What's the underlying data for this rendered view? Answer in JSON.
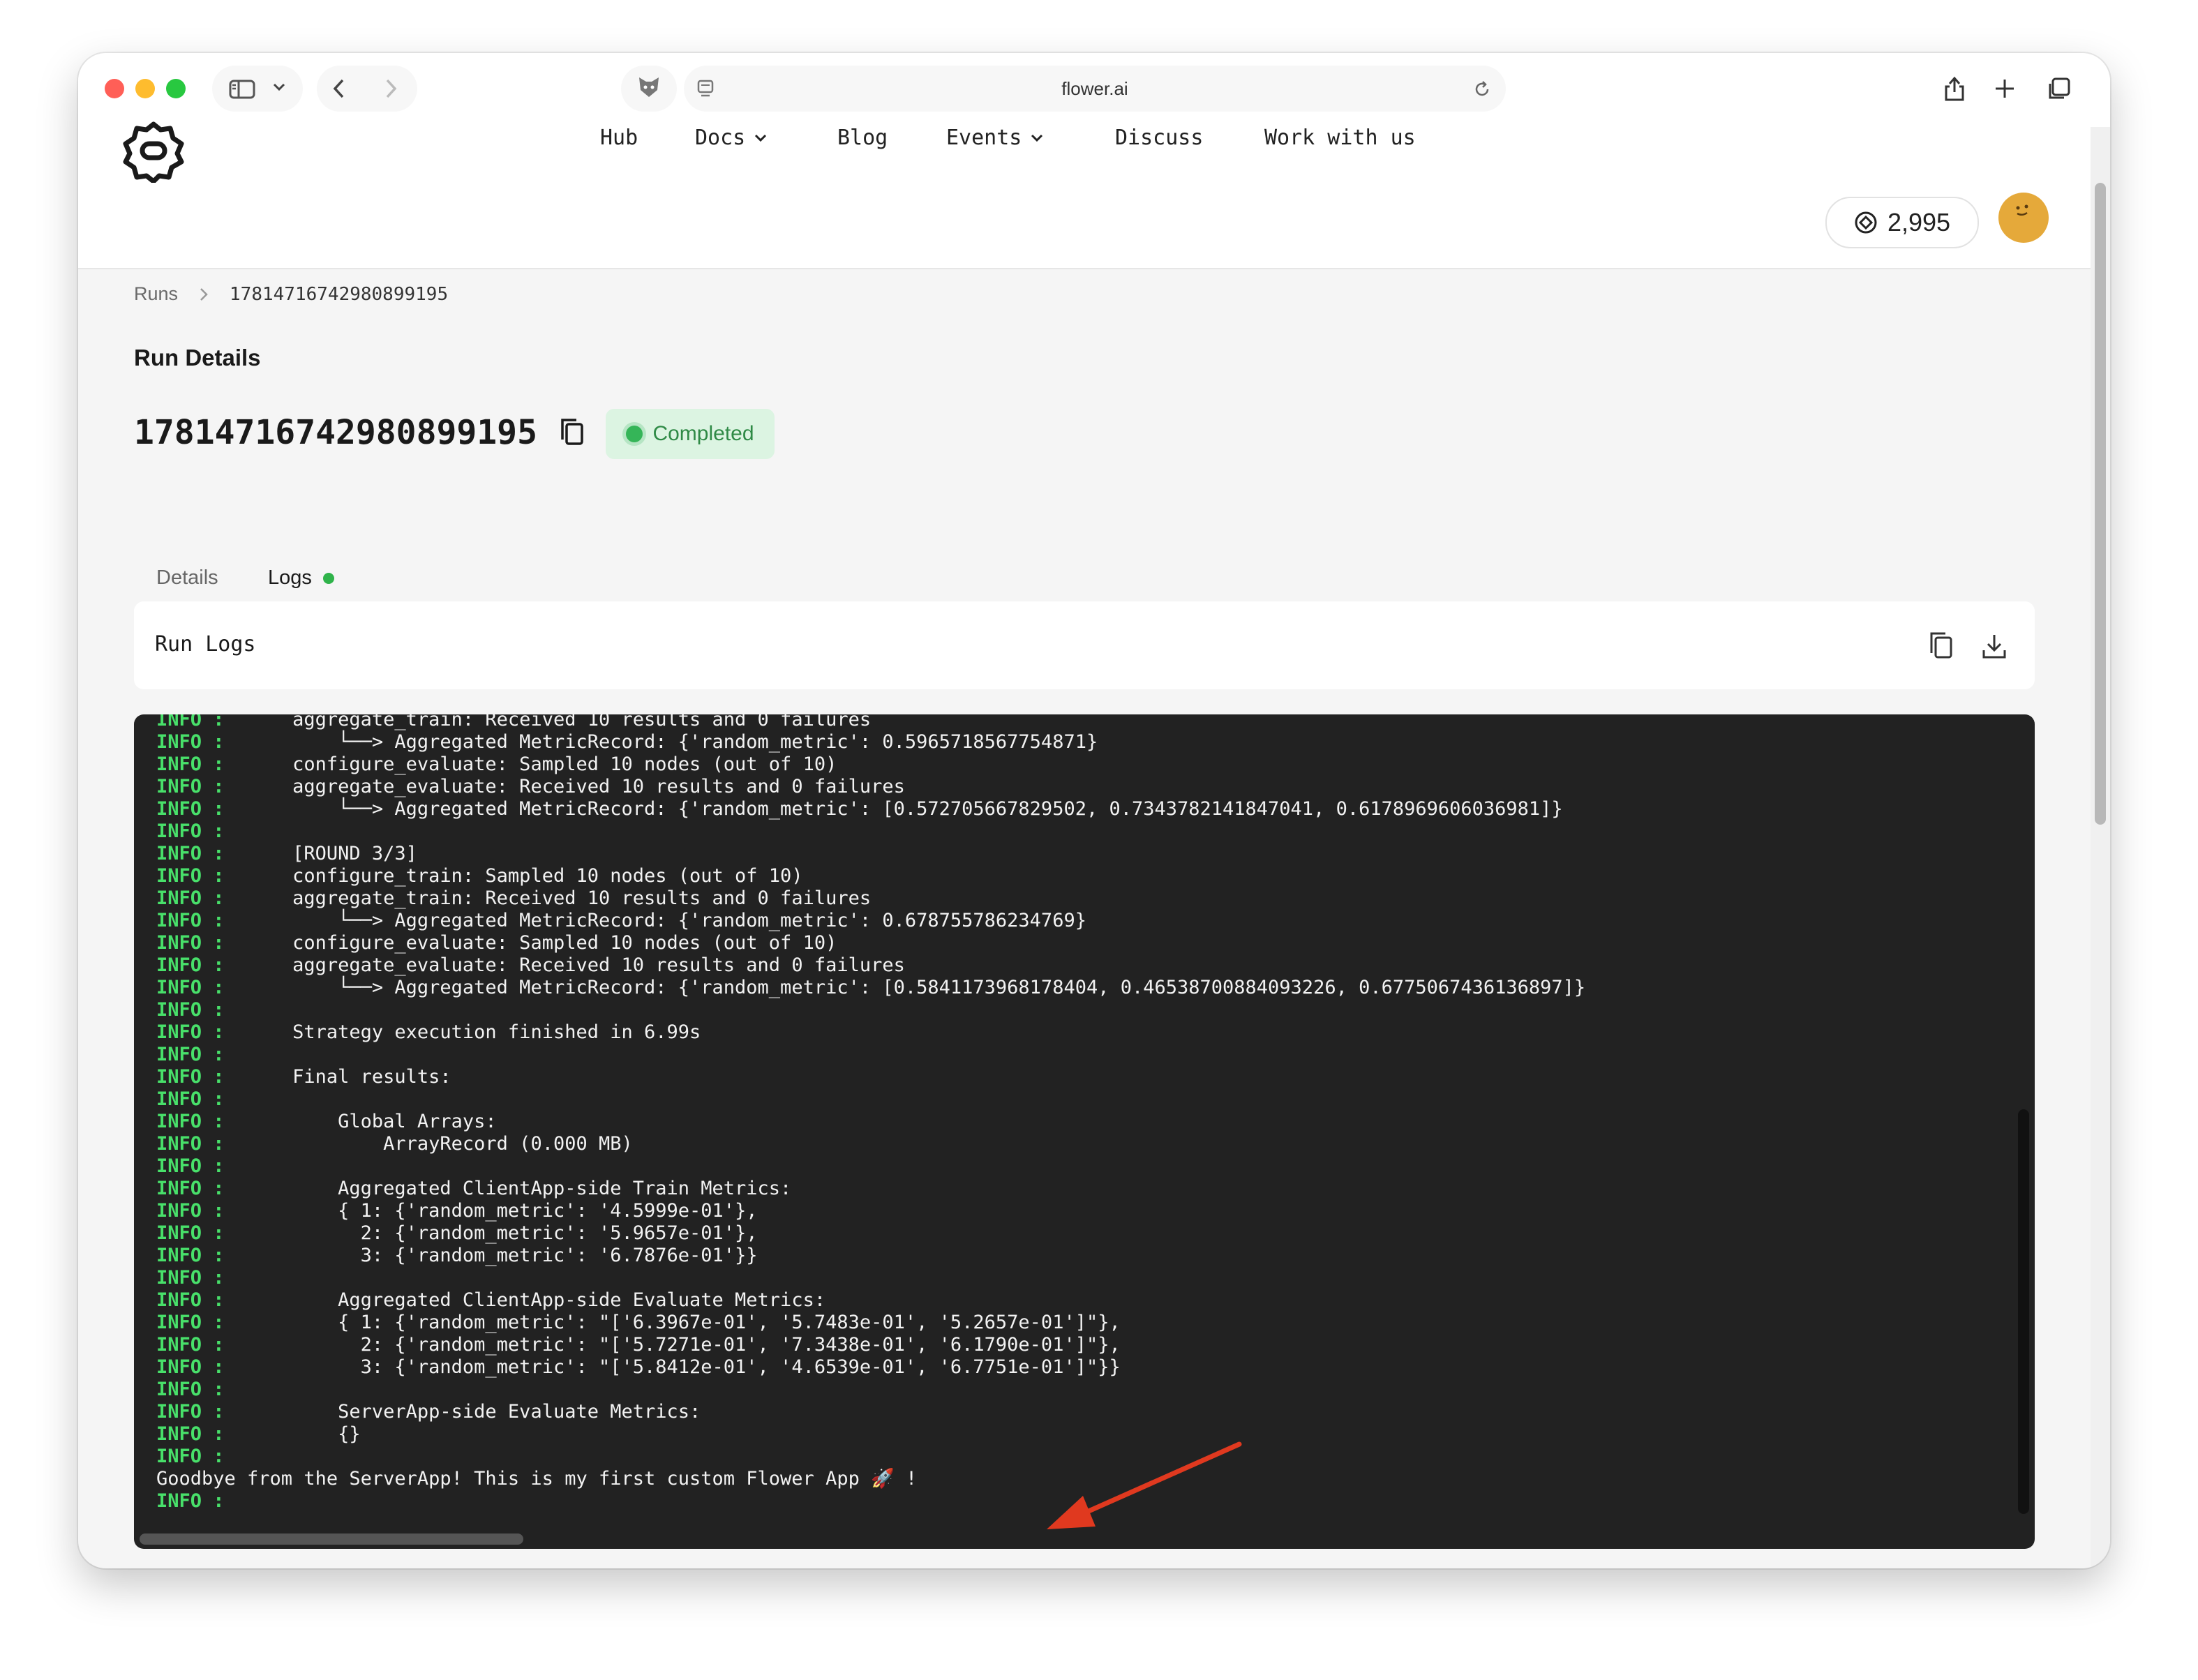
{
  "browser": {
    "url": "flower.ai"
  },
  "header": {
    "nav": [
      {
        "label": "Hub",
        "dropdown": false
      },
      {
        "label": "Docs",
        "dropdown": true
      },
      {
        "label": "Blog",
        "dropdown": false
      },
      {
        "label": "Events",
        "dropdown": true
      },
      {
        "label": "Discuss",
        "dropdown": false
      },
      {
        "label": "Work with us",
        "dropdown": false
      }
    ],
    "credits": "2,995"
  },
  "breadcrumb": {
    "parent": "Runs",
    "current": "17814716742980899195"
  },
  "page": {
    "section_title": "Run Details",
    "run_id": "17814716742980899195",
    "status": "Completed",
    "status_color": "#35b558"
  },
  "tabs": [
    {
      "label": "Details",
      "active": false
    },
    {
      "label": "Logs",
      "active": true
    }
  ],
  "logs": {
    "title": "Run Logs",
    "lines": [
      {
        "level": "INFO :",
        "text": "      aggregate_train: Received 10 results and 0 failures"
      },
      {
        "level": "INFO :",
        "text": "          └──> Aggregated MetricRecord: {'random_metric': 0.5965718567754871}"
      },
      {
        "level": "INFO :",
        "text": "      configure_evaluate: Sampled 10 nodes (out of 10)"
      },
      {
        "level": "INFO :",
        "text": "      aggregate_evaluate: Received 10 results and 0 failures"
      },
      {
        "level": "INFO :",
        "text": "          └──> Aggregated MetricRecord: {'random_metric': [0.572705667829502, 0.7343782141847041, 0.6178969606036981]}"
      },
      {
        "level": "INFO :",
        "text": ""
      },
      {
        "level": "INFO :",
        "text": "      [ROUND 3/3]"
      },
      {
        "level": "INFO :",
        "text": "      configure_train: Sampled 10 nodes (out of 10)"
      },
      {
        "level": "INFO :",
        "text": "      aggregate_train: Received 10 results and 0 failures"
      },
      {
        "level": "INFO :",
        "text": "          └──> Aggregated MetricRecord: {'random_metric': 0.678755786234769}"
      },
      {
        "level": "INFO :",
        "text": "      configure_evaluate: Sampled 10 nodes (out of 10)"
      },
      {
        "level": "INFO :",
        "text": "      aggregate_evaluate: Received 10 results and 0 failures"
      },
      {
        "level": "INFO :",
        "text": "          └──> Aggregated MetricRecord: {'random_metric': [0.5841173968178404, 0.46538700884093226, 0.6775067436136897]}"
      },
      {
        "level": "INFO :",
        "text": ""
      },
      {
        "level": "INFO :",
        "text": "      Strategy execution finished in 6.99s"
      },
      {
        "level": "INFO :",
        "text": ""
      },
      {
        "level": "INFO :",
        "text": "      Final results:"
      },
      {
        "level": "INFO :",
        "text": ""
      },
      {
        "level": "INFO :",
        "text": "          Global Arrays:"
      },
      {
        "level": "INFO :",
        "text": "              ArrayRecord (0.000 MB)"
      },
      {
        "level": "INFO :",
        "text": ""
      },
      {
        "level": "INFO :",
        "text": "          Aggregated ClientApp-side Train Metrics:"
      },
      {
        "level": "INFO :",
        "text": "          { 1: {'random_metric': '4.5999e-01'},"
      },
      {
        "level": "INFO :",
        "text": "            2: {'random_metric': '5.9657e-01'},"
      },
      {
        "level": "INFO :",
        "text": "            3: {'random_metric': '6.7876e-01'}}"
      },
      {
        "level": "INFO :",
        "text": ""
      },
      {
        "level": "INFO :",
        "text": "          Aggregated ClientApp-side Evaluate Metrics:"
      },
      {
        "level": "INFO :",
        "text": "          { 1: {'random_metric': \"['6.3967e-01', '5.7483e-01', '5.2657e-01']\"},"
      },
      {
        "level": "INFO :",
        "text": "            2: {'random_metric': \"['5.7271e-01', '7.3438e-01', '6.1790e-01']\"},"
      },
      {
        "level": "INFO :",
        "text": "            3: {'random_metric': \"['5.8412e-01', '4.6539e-01', '6.7751e-01']\"}}"
      },
      {
        "level": "INFO :",
        "text": ""
      },
      {
        "level": "INFO :",
        "text": "          ServerApp-side Evaluate Metrics:"
      },
      {
        "level": "INFO :",
        "text": "          {}"
      },
      {
        "level": "INFO :",
        "text": ""
      },
      {
        "level": "",
        "text": "Goodbye from the ServerApp! This is my first custom Flower App 🚀 !"
      },
      {
        "level": "INFO :",
        "text": ""
      }
    ]
  },
  "colors": {
    "terminal_bg": "#222222",
    "log_level": "#48e06a",
    "annotation_arrow": "#e0391f"
  }
}
